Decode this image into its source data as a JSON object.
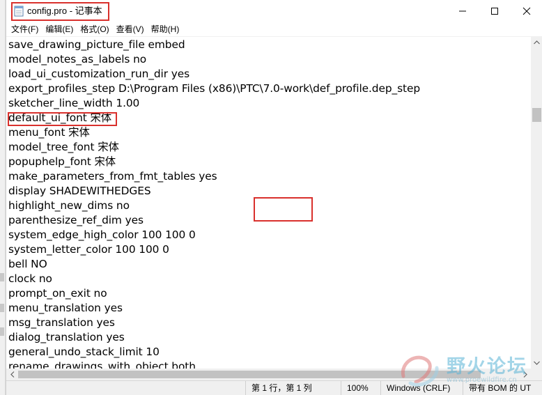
{
  "window": {
    "title": "config.pro - 记事本"
  },
  "menu": [
    {
      "label": "文件(F)"
    },
    {
      "label": "编辑(E)"
    },
    {
      "label": "格式(O)"
    },
    {
      "label": "查看(V)"
    },
    {
      "label": "帮助(H)"
    }
  ],
  "editor": {
    "lines": [
      "save_drawing_picture_file embed",
      "model_notes_as_labels no",
      "load_ui_customization_run_dir yes",
      "export_profiles_step D:\\Program Files (x86)\\PTC\\7.0-work\\def_profile.dep_step",
      "sketcher_line_width 1.00",
      "default_ui_font 宋体",
      "menu_font 宋体",
      "model_tree_font 宋体",
      "popuphelp_font 宋体",
      "make_parameters_from_fmt_tables yes",
      "display SHADEWITHEDGES",
      "highlight_new_dims no",
      "parenthesize_ref_dim yes",
      "system_edge_high_color 100 100 0",
      "system_letter_color 100 100 0",
      "bell NO",
      "clock no",
      "prompt_on_exit no",
      "menu_translation yes",
      "msg_translation yes",
      "dialog_translation yes",
      "general_undo_stack_limit 10",
      "rename_drawings_with_object both"
    ]
  },
  "status": {
    "position": "第 1 行，第 1 列",
    "zoom": "100%",
    "line_ending": "Windows (CRLF)",
    "encoding": "带有 BOM 的 UT"
  },
  "watermark": {
    "text": "野火论坛",
    "subtext": "www.proewildfire.cn"
  },
  "colors": {
    "annotation_red": "#d9302c",
    "chrome_gray": "#f0f0f0",
    "scroll_thumb": "#c2c2c2"
  },
  "icons": {
    "app": "notepad-icon",
    "minimize": "minimize-icon",
    "maximize": "maximize-icon",
    "close": "close-icon"
  }
}
